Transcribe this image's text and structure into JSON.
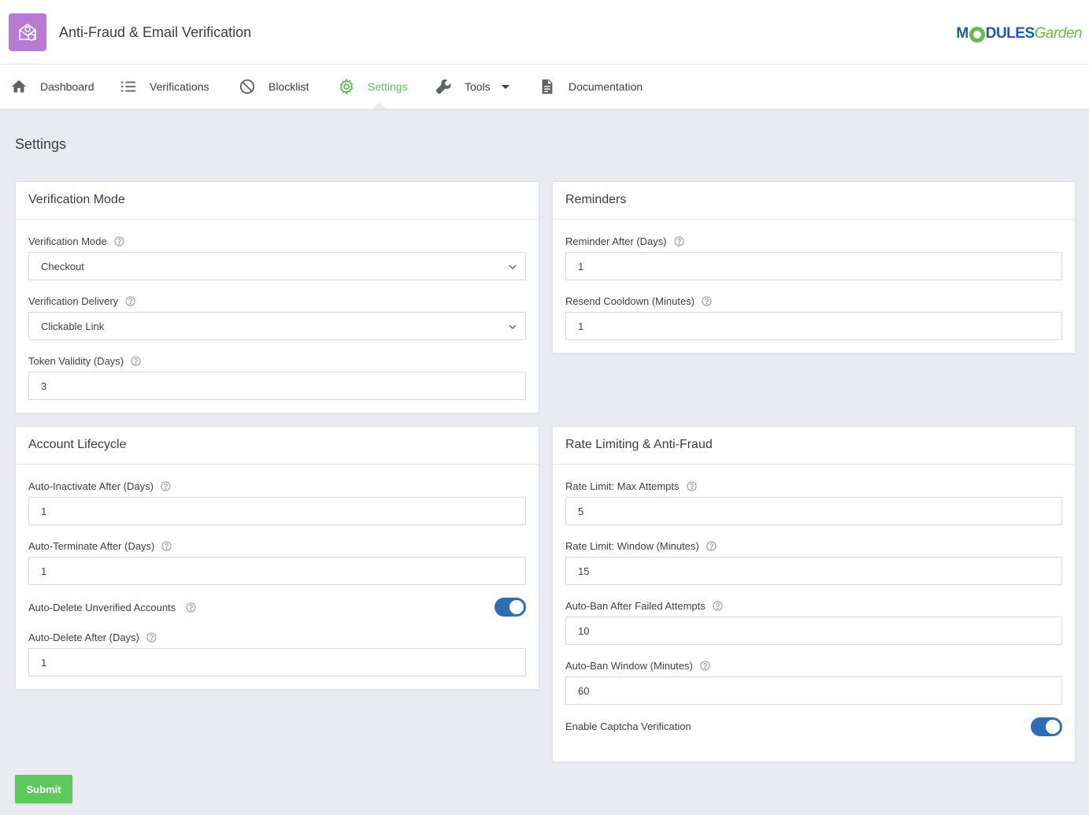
{
  "app": {
    "title": "Anti-Fraud & Email Verification",
    "brand_main": "M",
    "brand_rest": "DULES",
    "brand_garden": "Garden"
  },
  "nav": {
    "items": [
      {
        "label": "Dashboard"
      },
      {
        "label": "Verifications"
      },
      {
        "label": "Blocklist"
      },
      {
        "label": "Settings",
        "active": true
      },
      {
        "label": "Tools",
        "has_dropdown": true
      },
      {
        "label": "Documentation"
      }
    ],
    "active_color": "#5cc15c"
  },
  "page": {
    "title": "Settings"
  },
  "panels": {
    "verification_mode": {
      "title": "Verification Mode",
      "fields": {
        "mode": {
          "label": "Verification Mode",
          "value": "Checkout"
        },
        "delivery": {
          "label": "Verification Delivery",
          "value": "Clickable Link"
        },
        "token_validity": {
          "label": "Token Validity (Days)",
          "value": "3"
        }
      }
    },
    "reminders": {
      "title": "Reminders",
      "fields": {
        "reminder_after": {
          "label": "Reminder After (Days)",
          "value": "1"
        },
        "resend_cooldown": {
          "label": "Resend Cooldown (Minutes)",
          "value": "1"
        }
      }
    },
    "account_lifecycle": {
      "title": "Account Lifecycle",
      "fields": {
        "auto_inactivate": {
          "label": "Auto-Inactivate After (Days)",
          "value": "1"
        },
        "auto_terminate": {
          "label": "Auto-Terminate After (Days)",
          "value": "1"
        },
        "auto_delete_unverified": {
          "label": "Auto-Delete Unverified Accounts",
          "enabled": true
        },
        "auto_delete_after": {
          "label": "Auto-Delete After (Days)",
          "value": "1"
        }
      }
    },
    "rate_limiting": {
      "title": "Rate Limiting & Anti-Fraud",
      "fields": {
        "max_attempts": {
          "label": "Rate Limit: Max Attempts",
          "value": "5"
        },
        "window": {
          "label": "Rate Limit: Window (Minutes)",
          "value": "15"
        },
        "auto_ban_failed": {
          "label": "Auto-Ban After Failed Attempts",
          "value": "10"
        },
        "auto_ban_window": {
          "label": "Auto-Ban Window (Minutes)",
          "value": "60"
        },
        "captcha": {
          "label": "Enable Captcha Verification",
          "enabled": true
        }
      }
    }
  },
  "actions": {
    "submit_label": "Submit"
  },
  "colors": {
    "toggle_on": "#2f6db0",
    "submit": "#5ec85e",
    "app_icon": "#b77bd3"
  }
}
